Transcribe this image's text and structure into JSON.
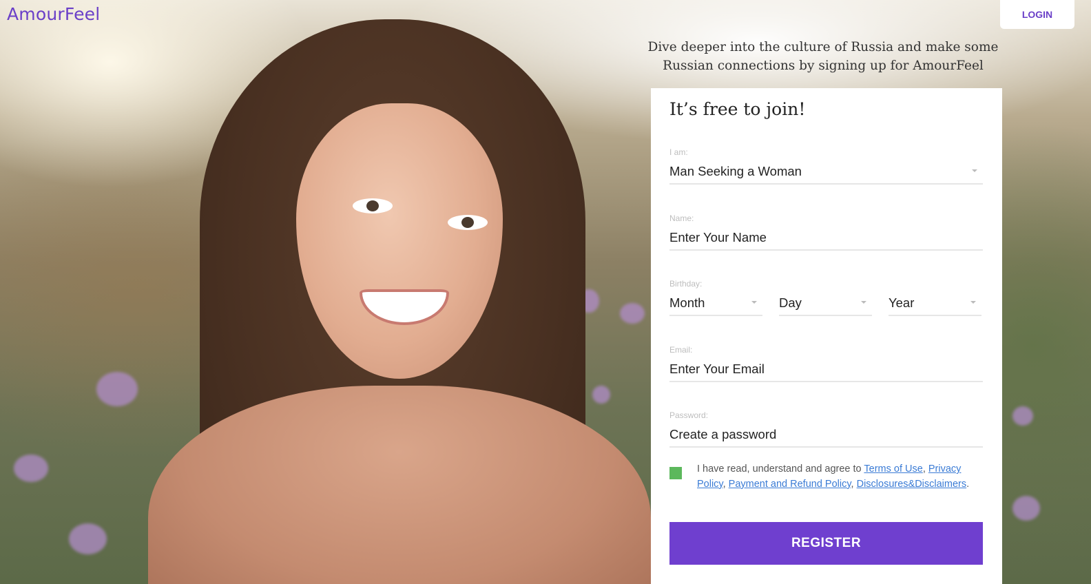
{
  "header": {
    "logo": "AmourFeel",
    "login_label": "LOGIN"
  },
  "tagline": "Dive deeper into the culture of Russia and make some Russian connections by signing up for AmourFeel",
  "form": {
    "title": "It’s free to join!",
    "iam": {
      "label": "I am:",
      "value": "Man Seeking a Woman"
    },
    "name": {
      "label": "Name:",
      "placeholder": "Enter Your Name"
    },
    "birthday": {
      "label": "Birthday:",
      "month": "Month",
      "day": "Day",
      "year": "Year"
    },
    "email": {
      "label": "Email:",
      "placeholder": "Enter Your Email"
    },
    "password": {
      "label": "Password:",
      "placeholder": "Create a password"
    },
    "agreement": {
      "text": "I have read, understand and agree to",
      "terms": "Terms of Use",
      "privacy": "Privacy Policy",
      "payment": "Payment and Refund Policy",
      "disclosures": "Disclosures&Disclaimers"
    },
    "register_label": "REGISTER"
  },
  "colors": {
    "brand": "#6a3fc8",
    "register_button": "#6f3fcf",
    "checkbox": "#5cb85c",
    "link": "#3a7bd5"
  }
}
